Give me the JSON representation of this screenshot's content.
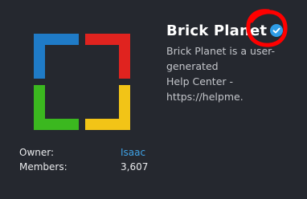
{
  "group": {
    "name": "Brick Planet",
    "verified_icon": "verified-check-icon",
    "description": "Brick Planet is a user-generated\nHelp Center - https://helpme.",
    "logo_colors": {
      "blue": "#1f7bc7",
      "red": "#e0231f",
      "green": "#3bb81f",
      "yellow": "#f2c417"
    }
  },
  "stats": {
    "owner_label": "Owner:",
    "owner_value": "Isaac",
    "members_label": "Members:",
    "members_value": "3,607"
  },
  "colors": {
    "background": "#25282f",
    "link": "#3fa2e6",
    "verified_badge": "#2e9ce6",
    "annotation_circle": "#ff0000"
  }
}
